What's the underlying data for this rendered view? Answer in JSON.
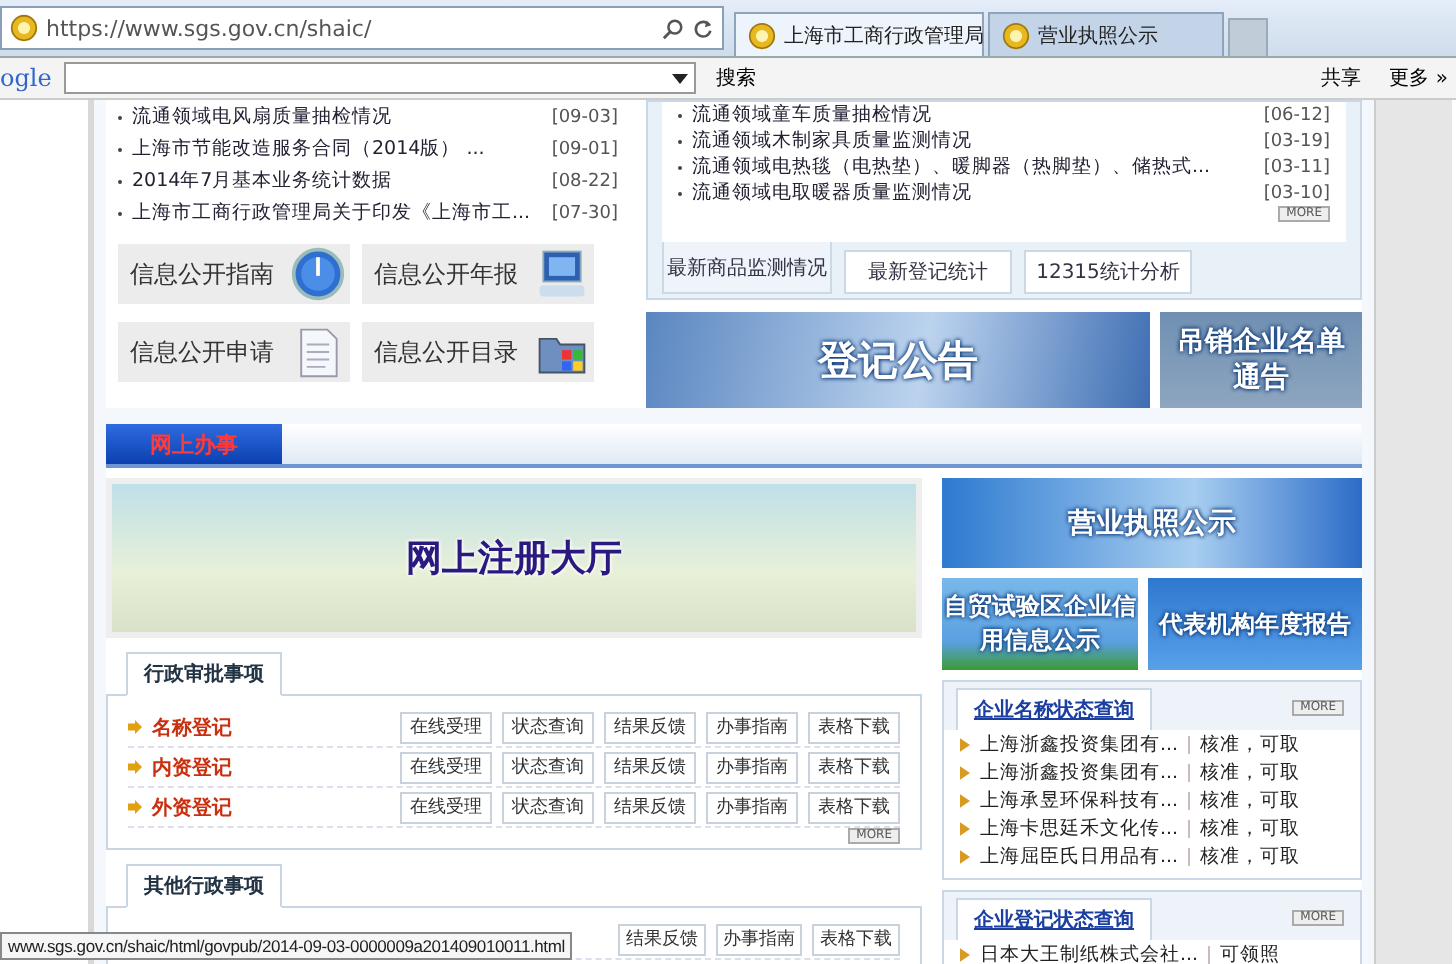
{
  "browser": {
    "address": "https://www.sgs.gov.cn/shaic/",
    "tabs": [
      {
        "label": "上海市工商行政管理局",
        "selected": true
      },
      {
        "label": "营业执照公示",
        "selected": false
      }
    ],
    "toolbar": {
      "logo": "ogle",
      "search_button": "搜索",
      "share": "共享",
      "more": "更多 »"
    }
  },
  "news_left": [
    {
      "title": "流通领域电风扇质量抽检情况",
      "date": "[09-03]"
    },
    {
      "title": "上海市节能改造服务合同（2014版） ...",
      "date": "[09-01]"
    },
    {
      "title": "2014年7月基本业务统计数据",
      "date": "[08-22]"
    },
    {
      "title": "上海市工商行政管理局关于印发《上海市工...",
      "date": "[07-30]"
    }
  ],
  "info_buttons": [
    {
      "label": "信息公开指南",
      "kind": "compass"
    },
    {
      "label": "信息公开年报",
      "kind": "computer"
    },
    {
      "label": "信息公开申请",
      "kind": "document"
    },
    {
      "label": "信息公开目录",
      "kind": "folder"
    }
  ],
  "news_right": {
    "items": [
      {
        "title": "流通领域童车质量抽检情况",
        "date": "[06-12]"
      },
      {
        "title": "流通领域木制家具质量监测情况",
        "date": "[03-19]"
      },
      {
        "title": "流通领域电热毯（电热垫）、暖脚器（热脚垫）、储热式...",
        "date": "[03-11]"
      },
      {
        "title": "流通领域电取暖器质量监测情况",
        "date": "[03-10]"
      }
    ],
    "more": "MORE",
    "tabs": [
      {
        "label": "最新商品监测情况",
        "selected": true
      },
      {
        "label": "最新登记统计",
        "selected": false
      },
      {
        "label": "12315统计分析",
        "selected": false
      }
    ]
  },
  "banners_top": [
    "登记公告",
    "吊销企业名单通告"
  ],
  "section_tab": "网上办事",
  "hall_banner": "网上注册大厅",
  "side_banners": [
    "营业执照公示",
    "自贸试验区企业信用信息公示",
    "代表机构年度报告"
  ],
  "approval": {
    "tab": "行政审批事项",
    "rows": [
      {
        "name": "名称登记",
        "actions": [
          "在线受理",
          "状态查询",
          "结果反馈",
          "办事指南",
          "表格下载"
        ]
      },
      {
        "name": "内资登记",
        "actions": [
          "在线受理",
          "状态查询",
          "结果反馈",
          "办事指南",
          "表格下载"
        ]
      },
      {
        "name": "外资登记",
        "actions": [
          "在线受理",
          "状态查询",
          "结果反馈",
          "办事指南",
          "表格下载"
        ]
      }
    ],
    "more": "MORE"
  },
  "other": {
    "tab": "其他行政事项",
    "actions": [
      "结果反馈",
      "办事指南",
      "表格下载"
    ]
  },
  "name_query": {
    "title": "企业名称状态查询",
    "more": "MORE",
    "items": [
      {
        "name": "上海浙鑫投资集团有...",
        "status": "核准，可取"
      },
      {
        "name": "上海浙鑫投资集团有...",
        "status": "核准，可取"
      },
      {
        "name": "上海承昱环保科技有...",
        "status": "核准，可取"
      },
      {
        "name": "上海卡思廷禾文化传...",
        "status": "核准，可取"
      },
      {
        "name": "上海屈臣氏日用品有...",
        "status": "核准，可取"
      }
    ]
  },
  "reg_query": {
    "title": "企业登记状态查询",
    "more": "MORE",
    "items": [
      {
        "name": "日本大王制纸株式会社...",
        "status": "可领照"
      }
    ]
  },
  "status_url": "www.sgs.gov.cn/shaic/html/govpub/2014-09-03-0000009a201409010011.html"
}
